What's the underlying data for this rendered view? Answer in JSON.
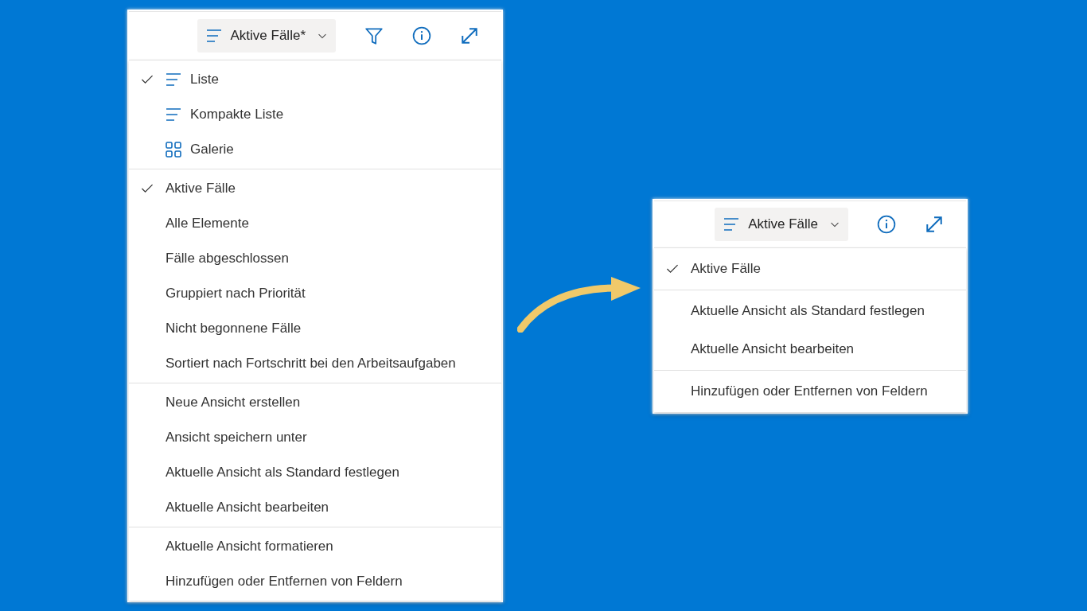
{
  "panels": [
    {
      "toolbar": {
        "view_button": {
          "label": "Aktive Fälle*"
        },
        "tools": [
          {
            "kind": "filter"
          },
          {
            "kind": "info"
          },
          {
            "kind": "expand"
          }
        ]
      },
      "menu": [
        [
          {
            "kind": "list",
            "label": "Liste",
            "checked": true
          },
          {
            "kind": "list",
            "label": "Kompakte Liste",
            "checked": false
          },
          {
            "kind": "grid",
            "label": "Galerie",
            "checked": false
          }
        ],
        [
          {
            "kind": "text",
            "label": "Aktive Fälle",
            "checked": true
          },
          {
            "kind": "text",
            "label": "Alle Elemente",
            "checked": false
          },
          {
            "kind": "text",
            "label": "Fälle abgeschlossen",
            "checked": false
          },
          {
            "kind": "text",
            "label": "Gruppiert nach Priorität",
            "checked": false
          },
          {
            "kind": "text",
            "label": "Nicht begonnene Fälle",
            "checked": false
          },
          {
            "kind": "text",
            "label": "Sortiert nach Fortschritt bei den Arbeitsaufgaben",
            "checked": false
          }
        ],
        [
          {
            "kind": "text",
            "label": "Neue Ansicht erstellen",
            "checked": false
          },
          {
            "kind": "text",
            "label": "Ansicht speichern unter",
            "checked": false
          },
          {
            "kind": "text",
            "label": "Aktuelle Ansicht als Standard festlegen",
            "checked": false
          },
          {
            "kind": "text",
            "label": "Aktuelle Ansicht bearbeiten",
            "checked": false
          }
        ],
        [
          {
            "kind": "text",
            "label": "Aktuelle Ansicht formatieren",
            "checked": false
          },
          {
            "kind": "text",
            "label": "Hinzufügen oder Entfernen von Feldern",
            "checked": false
          }
        ]
      ]
    },
    {
      "toolbar": {
        "view_button": {
          "label": "Aktive Fälle"
        },
        "tools": [
          {
            "kind": "info"
          },
          {
            "kind": "expand"
          }
        ]
      },
      "menu": [
        [
          {
            "kind": "text",
            "label": "Aktive Fälle",
            "checked": true
          }
        ],
        [
          {
            "kind": "text",
            "label": "Aktuelle Ansicht als Standard festlegen",
            "checked": false
          },
          {
            "kind": "text",
            "label": "Aktuelle Ansicht bearbeiten",
            "checked": false
          }
        ],
        [
          {
            "kind": "text",
            "label": "Hinzufügen oder Entfernen von Feldern",
            "checked": false
          }
        ]
      ]
    }
  ]
}
